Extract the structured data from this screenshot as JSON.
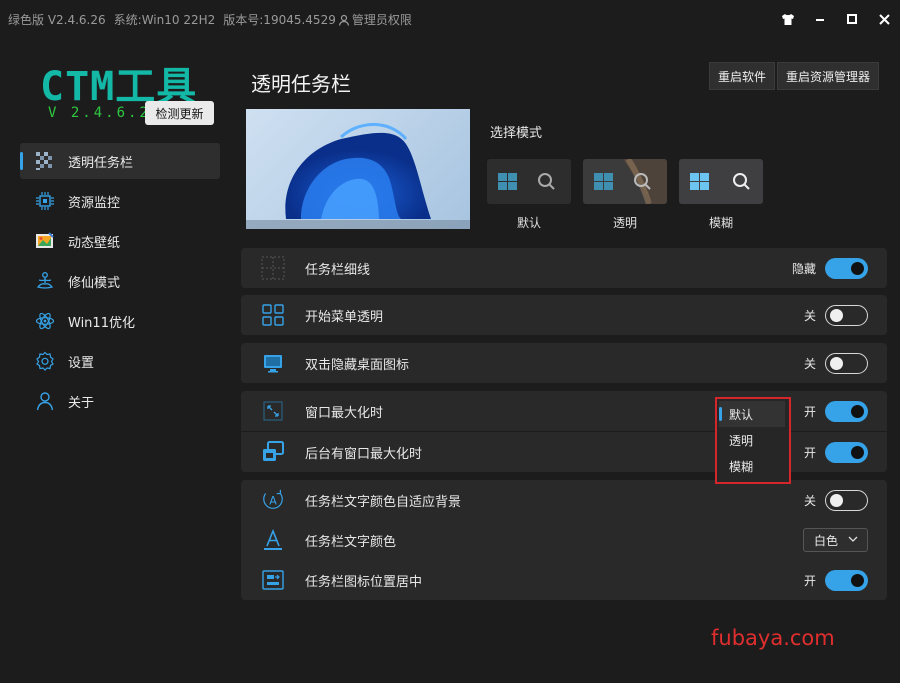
{
  "titlebar": {
    "edition": "绿色版 V2.4.6.26",
    "system": "系统:Win10 22H2",
    "build": "版本号:19045.4529",
    "privilege": "管理员权限"
  },
  "brand": {
    "logo": "CTM工具",
    "version": "V 2.4.6.26",
    "update_label": "检测更新"
  },
  "sidebar": {
    "items": [
      {
        "label": "透明任务栏",
        "icon": "checker-icon"
      },
      {
        "label": "资源监控",
        "icon": "chip-icon"
      },
      {
        "label": "动态壁纸",
        "icon": "wallpaper-icon"
      },
      {
        "label": "修仙模式",
        "icon": "meditation-icon"
      },
      {
        "label": "Win11优化",
        "icon": "atom-icon"
      },
      {
        "label": "设置",
        "icon": "gear-icon"
      },
      {
        "label": "关于",
        "icon": "user-icon"
      }
    ]
  },
  "header": {
    "title": "透明任务栏",
    "restart_app": "重启软件",
    "restart_explorer": "重启资源管理器"
  },
  "mode": {
    "label": "选择模式",
    "options": [
      "默认",
      "透明",
      "模糊"
    ],
    "selected": "模糊"
  },
  "settings": {
    "grid_lines": {
      "label": "任务栏细线",
      "state": "隐藏",
      "on": true
    },
    "start_menu": {
      "label": "开始菜单透明",
      "state": "关",
      "on": false
    },
    "hide_icons": {
      "label": "双击隐藏桌面图标",
      "state": "关",
      "on": false
    },
    "maximized": {
      "label": "窗口最大化时",
      "state": "开",
      "on": true
    },
    "bg_maximized": {
      "label": "后台有窗口最大化时",
      "state": "开",
      "on": true
    },
    "text_adapt": {
      "label": "任务栏文字颜色自适应背景",
      "state": "关",
      "on": false
    },
    "text_color": {
      "label": "任务栏文字颜色",
      "value": "白色"
    },
    "icon_center": {
      "label": "任务栏图标位置居中",
      "state": "开",
      "on": true
    }
  },
  "dropdown": {
    "items": [
      "默认",
      "透明",
      "模糊"
    ],
    "selected": "默认"
  },
  "watermark": "fubaya.com",
  "colors": {
    "accent": "#36a3e8",
    "logo": "#14b8a6",
    "version": "#2ec840",
    "highlight_border": "#d4262b",
    "watermark": "#e02e2e"
  }
}
